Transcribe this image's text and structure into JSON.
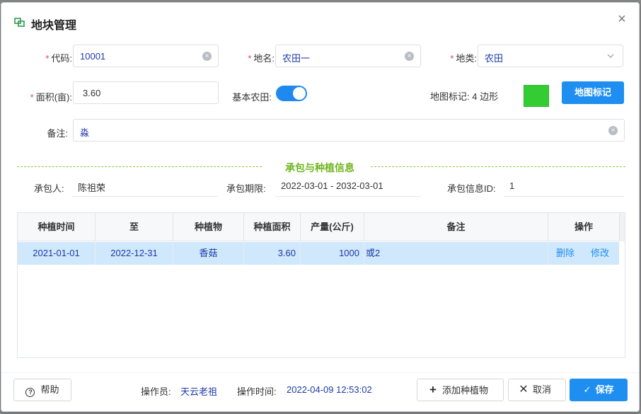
{
  "dialog": {
    "title": "地块管理",
    "close_glyph": "×"
  },
  "form": {
    "code": {
      "label": "代码:",
      "value": "10001"
    },
    "name": {
      "label": "地名:",
      "value": "农田一"
    },
    "type": {
      "label": "地类:",
      "value": "农田"
    },
    "area": {
      "label": "面积(亩):",
      "value": "3.60"
    },
    "basic_farmland": {
      "label": "基本农田:",
      "checked": true
    },
    "map_mark": {
      "label": "地图标记: 4 边形",
      "color": "#33cc33",
      "button": "地图标记"
    },
    "remark": {
      "label": "备注:",
      "value": "淼"
    },
    "required_mark": "*"
  },
  "section": {
    "title": "承包与种植信息"
  },
  "contract": {
    "person_label": "承包人:",
    "person_value": "陈祖荣",
    "period_label": "承包期限:",
    "period_value": "2022-03-01 - 2032-03-01",
    "id_label": "承包信息ID:",
    "id_value": "1"
  },
  "table": {
    "columns": [
      "种植时间",
      "至",
      "种植物",
      "种植面积",
      "产量(公斤)",
      "备注",
      "操作"
    ],
    "rows": [
      {
        "start": "2021-01-01",
        "end": "2022-12-31",
        "crop": "香菇",
        "area": "3.60",
        "yield": "1000",
        "remark": "或2",
        "delete": "删除",
        "edit": "修改"
      }
    ]
  },
  "footer": {
    "help": "帮助",
    "operator_label": "操作员:",
    "operator_value": "天云老祖",
    "time_label": "操作时间:",
    "time_value": "2022-04-09 12:53:02",
    "add_crop": "添加种植物",
    "cancel": "取消",
    "save": "保存"
  },
  "colors": {
    "primary": "#1f8ef1",
    "section_green": "#6fb61f",
    "selected_row": "#cfe8fb",
    "value_text": "#1c3aa8"
  },
  "icons": [
    "layers-icon",
    "close-icon",
    "clear-icon",
    "chevron-down-icon",
    "help-icon",
    "plus-icon",
    "x-icon",
    "check-icon"
  ]
}
